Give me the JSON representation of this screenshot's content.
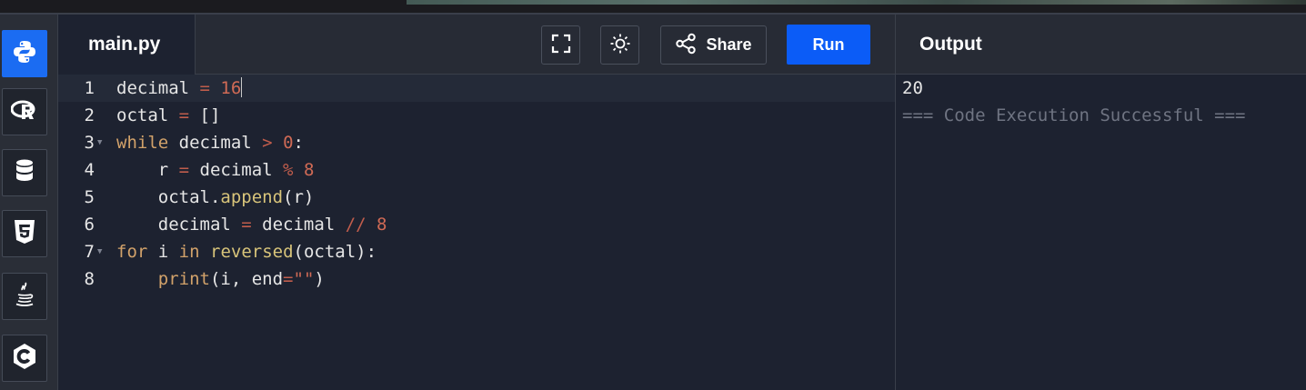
{
  "header": {
    "file_tab": "main.py",
    "share_label": "Share",
    "run_label": "Run",
    "output_title": "Output"
  },
  "sidebar": {
    "items": [
      {
        "icon": "python-icon",
        "active": true
      },
      {
        "icon": "r-icon"
      },
      {
        "icon": "database-icon"
      },
      {
        "icon": "html5-icon"
      },
      {
        "icon": "java-icon"
      },
      {
        "icon": "c-icon"
      }
    ]
  },
  "editor": {
    "lines": [
      {
        "n": "1",
        "text": "decimal = 16"
      },
      {
        "n": "2",
        "text": "octal = []"
      },
      {
        "n": "3",
        "text": "while decimal > 0:"
      },
      {
        "n": "4",
        "text": "    r = decimal % 8"
      },
      {
        "n": "5",
        "text": "    octal.append(r)"
      },
      {
        "n": "6",
        "text": "    decimal = decimal // 8"
      },
      {
        "n": "7",
        "text": "for i in reversed(octal):"
      },
      {
        "n": "8",
        "text": "    print(i, end=\"\")"
      }
    ]
  },
  "output": {
    "lines": [
      "20",
      "=== Code Execution Successful ==="
    ]
  },
  "colors": {
    "run_button": "#0b5cf7",
    "active_language": "#1b6cf2",
    "background": "#1d2230"
  }
}
